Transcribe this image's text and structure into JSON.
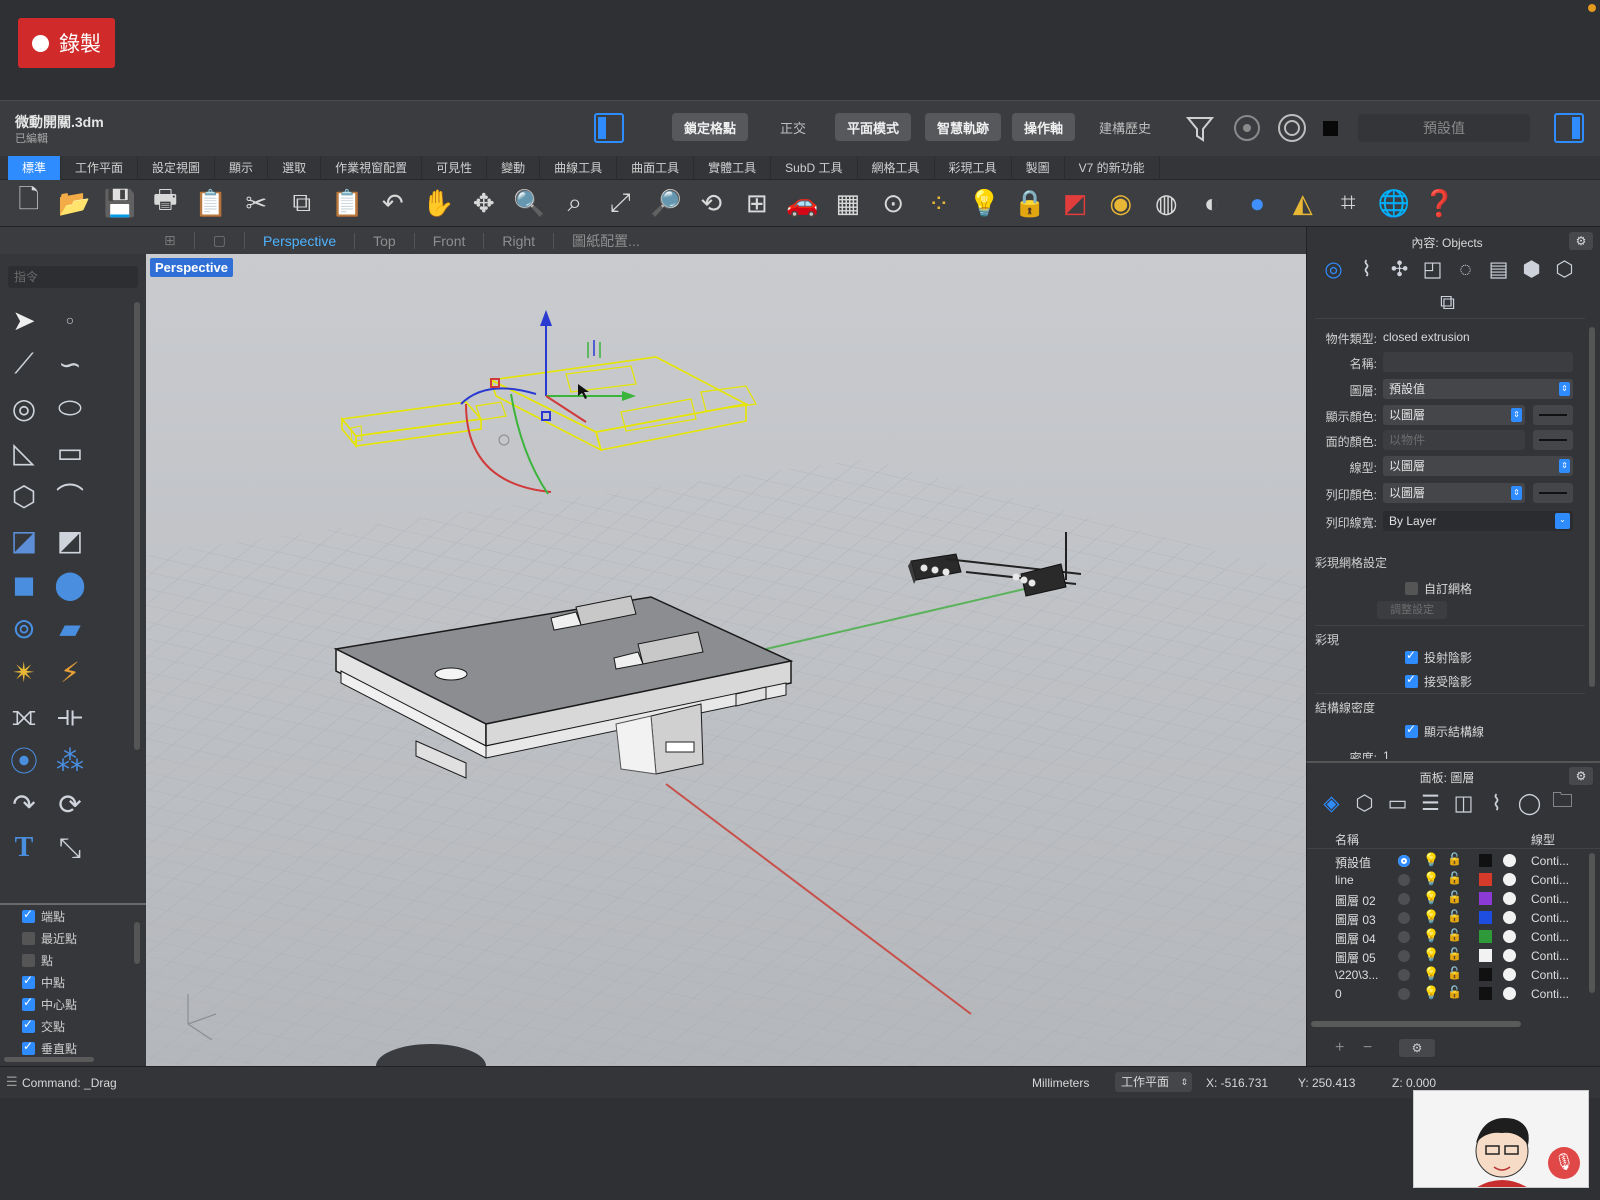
{
  "recording": {
    "label": "錄製"
  },
  "document": {
    "name": "微動開關.3dm",
    "status": "已編輯"
  },
  "titlebar": {
    "toggles": [
      {
        "label": "鎖定格點",
        "on": true
      },
      {
        "label": "正交",
        "on": false
      },
      {
        "label": "平面模式",
        "on": true
      },
      {
        "label": "智慧軌跡",
        "on": true
      },
      {
        "label": "操作軸",
        "on": true
      },
      {
        "label": "建構歷史",
        "on": false
      }
    ],
    "default_value": "預設值"
  },
  "tabs": [
    "標準",
    "工作平面",
    "設定視圖",
    "顯示",
    "選取",
    "作業視窗配置",
    "可見性",
    "變動",
    "曲線工具",
    "曲面工具",
    "實體工具",
    "SubD 工具",
    "網格工具",
    "彩現工具",
    "製圖",
    "V7 的新功能"
  ],
  "viewport_tabs": [
    "Perspective",
    "Top",
    "Front",
    "Right",
    "圖紙配置..."
  ],
  "viewport": {
    "label": "Perspective"
  },
  "sidebar": {
    "command_placeholder": "指令",
    "snaps": [
      {
        "label": "端點",
        "checked": true
      },
      {
        "label": "最近點",
        "checked": false
      },
      {
        "label": "點",
        "checked": false
      },
      {
        "label": "中點",
        "checked": true
      },
      {
        "label": "中心點",
        "checked": true
      },
      {
        "label": "交點",
        "checked": true
      },
      {
        "label": "垂直點",
        "checked": true
      }
    ]
  },
  "properties": {
    "title": "內容: Objects",
    "object_type_label": "物件類型:",
    "object_type": "closed extrusion",
    "name_label": "名稱:",
    "layer_label": "圖層:",
    "layer_value": "預設值",
    "display_color_label": "顯示顏色:",
    "display_color_value": "以圖層",
    "face_color_label": "面的顏色:",
    "face_color_value": "以物件",
    "linetype_label": "線型:",
    "linetype_value": "以圖層",
    "print_color_label": "列印顏色:",
    "print_color_value": "以圖層",
    "print_width_label": "列印線寬:",
    "print_width_value": "By Layer",
    "render_mesh_head": "彩現網格設定",
    "custom_mesh_label": "自訂網格",
    "adjust_button": "調整設定",
    "render_head": "彩現",
    "cast_shadow_label": "投射陰影",
    "receive_shadow_label": "接受陰影",
    "isocurve_head": "結構線密度",
    "show_isocurve_label": "顯示結構線",
    "density_label": "密度:",
    "density_value": "1"
  },
  "layers": {
    "title": "面板: 圖層",
    "col_name": "名稱",
    "col_linetype": "線型",
    "rows": [
      {
        "name": "預設值",
        "current": true,
        "color": "#111111",
        "linetype": "Conti..."
      },
      {
        "name": "line",
        "current": false,
        "color": "#d63a2a",
        "linetype": "Conti..."
      },
      {
        "name": "圖層 02",
        "current": false,
        "color": "#8b3ad6",
        "linetype": "Conti..."
      },
      {
        "name": "圖層 03",
        "current": false,
        "color": "#1e4ee0",
        "linetype": "Conti..."
      },
      {
        "name": "圖層 04",
        "current": false,
        "color": "#2f9a3a",
        "linetype": "Conti..."
      },
      {
        "name": "圖層 05",
        "current": false,
        "color": "#f2f2f2",
        "linetype": "Conti..."
      },
      {
        "name": "\\220\\3...",
        "current": false,
        "color": "#111111",
        "linetype": "Conti..."
      },
      {
        "name": "0",
        "current": false,
        "color": "#111111",
        "linetype": "Conti..."
      }
    ]
  },
  "status": {
    "command": "Command: _Drag",
    "units": "Millimeters",
    "plane": "工作平面",
    "x": "X: -516.731",
    "y": "Y: 250.413",
    "z": "Z: 0.000"
  }
}
